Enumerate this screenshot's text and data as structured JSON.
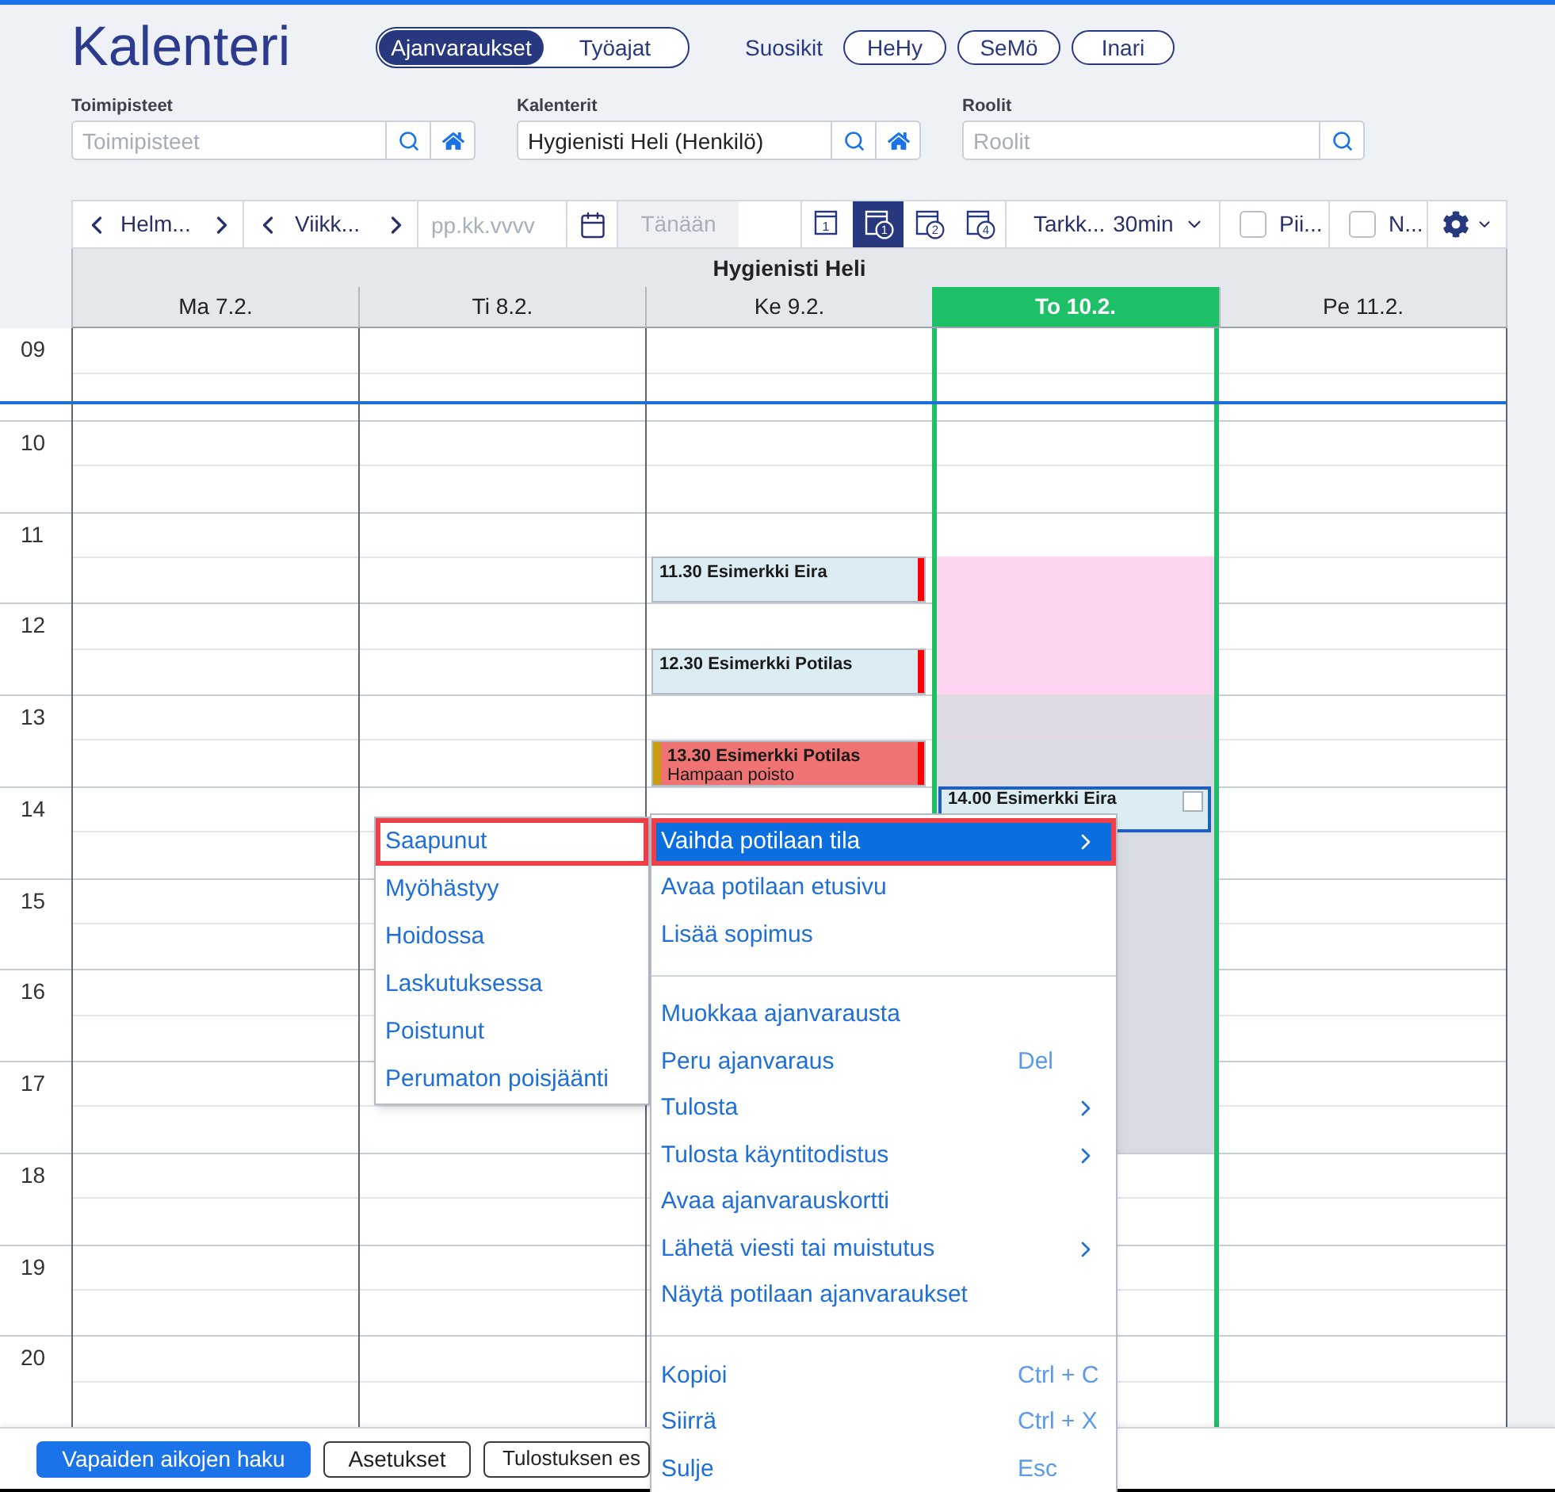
{
  "header": {
    "title": "Kalenteri",
    "view_tabs": [
      {
        "label": "Ajanvaraukset",
        "selected": true
      },
      {
        "label": "Työajat",
        "selected": false
      }
    ],
    "favorites_label": "Suosikit",
    "favorites": [
      "HeHy",
      "SeMö",
      "Inari"
    ]
  },
  "filters": [
    {
      "label": "Toimipisteet",
      "placeholder": "Toimipisteet",
      "home_button": true
    },
    {
      "label": "Kalenterit",
      "value": "Hygienisti Heli (Henkilö)",
      "home_button": true
    },
    {
      "label": "Roolit",
      "placeholder": "Roolit",
      "home_button": false
    }
  ],
  "toolbar": {
    "month": "Helm...",
    "week": "Viikk...",
    "date_placeholder": "pp.kk.vvvv",
    "today": {
      "label": "Tänään",
      "disabled": true
    },
    "view_modes": [
      {
        "label": "1",
        "kind": "page",
        "selected": false
      },
      {
        "label": "1",
        "kind": "circle",
        "selected": true
      },
      {
        "label": "2",
        "kind": "circle",
        "selected": false
      },
      {
        "label": "4",
        "kind": "circle",
        "selected": false
      }
    ],
    "precision": {
      "label": "Tarkk...",
      "value": "30min"
    },
    "checkboxes": [
      {
        "label": "Pii...",
        "checked": false
      },
      {
        "label": "N...",
        "checked": false
      }
    ]
  },
  "calendar": {
    "resource": "Hygienisti Heli",
    "hours": [
      "09",
      "10",
      "11",
      "12",
      "13",
      "14",
      "15",
      "16",
      "17",
      "18",
      "19",
      "20"
    ],
    "days": [
      {
        "label": "Ma 7.2.",
        "today": false
      },
      {
        "label": "Ti 8.2.",
        "today": false
      },
      {
        "label": "Ke 9.2.",
        "today": false,
        "slots": [
          {
            "kind": "free"
          },
          {
            "kind": "free"
          },
          {
            "kind": "free"
          },
          {
            "kind": "free"
          },
          {
            "kind": "free"
          },
          {
            "kind": "free",
            "event": {
              "title": "11.30 Esimerkki Eira",
              "color": "#dbecf3",
              "selected": false,
              "markers": [
                {
                  "kind": "right",
                  "color": "#ff0000"
                }
              ]
            }
          },
          {
            "kind": "free"
          },
          {
            "kind": "free",
            "event": {
              "title": "12.30 Esimerkki Potilas",
              "color": "#dbecf3",
              "selected": false,
              "markers": [
                {
                  "kind": "right",
                  "color": "#ff0000"
                }
              ]
            }
          },
          {
            "kind": "free"
          },
          {
            "kind": "free",
            "event": {
              "title": "13.30 Esimerkki Potilas",
              "subtitle": "Hampaan poisto",
              "color": "#ef7373",
              "selected": false,
              "markers": [
                {
                  "kind": "left",
                  "color": "#c89c10"
                },
                {
                  "kind": "right",
                  "color": "#ff0000"
                }
              ]
            }
          }
        ]
      },
      {
        "label": "To 10.2.",
        "today": true,
        "slots": [
          {
            "kind": "free"
          },
          {
            "kind": "free"
          },
          {
            "kind": "free"
          },
          {
            "kind": "free"
          },
          {
            "kind": "free"
          },
          {
            "kind": "reserved",
            "color": "#fdd5f0"
          },
          {
            "kind": "reserved",
            "color": "#fdd5f0"
          },
          {
            "kind": "reserved",
            "color": "#fdd5f0"
          },
          {
            "kind": "reserved",
            "color": "#e0d8e3"
          },
          {
            "kind": "reserved",
            "color": "#d8dbe2"
          },
          {
            "kind": "reserved",
            "color": "#d8dbe2",
            "event": {
              "title": "14.00 Esimerkki Eira",
              "color": "#dbecf3",
              "selected": true,
              "checkbox": {
                "checked": false
              }
            }
          },
          {
            "kind": "reserved",
            "color": "#d8dbe2"
          },
          {
            "kind": "reserved",
            "color": "#d8dbe2"
          },
          {
            "kind": "reserved",
            "color": "#d8dbe2"
          },
          {
            "kind": "reserved",
            "color": "#d8dbe2"
          },
          {
            "kind": "reserved",
            "color": "#d8dbe2"
          },
          {
            "kind": "reserved",
            "color": "#d8dbe2"
          },
          {
            "kind": "reserved",
            "color": "#d8dbe2"
          }
        ]
      },
      {
        "label": "Pe 11.2.",
        "today": false
      }
    ]
  },
  "status_menu": {
    "items": [
      {
        "label": "Saapunut",
        "marked": true
      },
      {
        "label": "Myöhästyy",
        "marked": false
      },
      {
        "label": "Hoidossa",
        "marked": false
      },
      {
        "label": "Laskutuksessa",
        "marked": false
      },
      {
        "label": "Poistunut",
        "marked": false
      },
      {
        "label": "Perumaton poisjäänti",
        "marked": false
      }
    ]
  },
  "context_menu": {
    "items": [
      {
        "kind": "item",
        "label": "Vaihda potilaan tila",
        "selected": true,
        "marked": true,
        "submenu": true
      },
      {
        "kind": "item",
        "label": "Avaa potilaan etusivu",
        "selected": false,
        "marked": false,
        "submenu": false
      },
      {
        "kind": "item",
        "label": "Lisää sopimus",
        "selected": false,
        "marked": false,
        "submenu": false
      },
      {
        "kind": "separator"
      },
      {
        "kind": "item",
        "label": "Muokkaa ajanvarausta",
        "selected": false,
        "marked": false,
        "submenu": false
      },
      {
        "kind": "item",
        "label": "Peru ajanvaraus",
        "shortcut": "Del",
        "selected": false,
        "marked": false,
        "submenu": false
      },
      {
        "kind": "item",
        "label": "Tulosta",
        "selected": false,
        "marked": false,
        "submenu": true
      },
      {
        "kind": "item",
        "label": "Tulosta käyntitodistus",
        "selected": false,
        "marked": false,
        "submenu": true
      },
      {
        "kind": "item",
        "label": "Avaa ajanvarauskortti",
        "selected": false,
        "marked": false,
        "submenu": false
      },
      {
        "kind": "item",
        "label": "Lähetä viesti tai muistutus",
        "selected": false,
        "marked": false,
        "submenu": true
      },
      {
        "kind": "item",
        "label": "Näytä potilaan ajanvaraukset",
        "selected": false,
        "marked": false,
        "submenu": false
      },
      {
        "kind": "separator"
      },
      {
        "kind": "item",
        "label": "Kopioi",
        "shortcut": "Ctrl + C",
        "selected": false,
        "marked": false,
        "submenu": false
      },
      {
        "kind": "item",
        "label": "Siirrä",
        "shortcut": "Ctrl + X",
        "selected": false,
        "marked": false,
        "submenu": false
      },
      {
        "kind": "item",
        "label": "Sulje",
        "shortcut": "Esc",
        "selected": false,
        "marked": false,
        "submenu": false
      }
    ]
  },
  "footer": {
    "buttons": [
      {
        "label": "Vapaiden aikojen haku",
        "primary": true
      },
      {
        "label": "Asetukset",
        "primary": false
      },
      {
        "label": "Tulostuksen es",
        "primary": false
      }
    ]
  }
}
